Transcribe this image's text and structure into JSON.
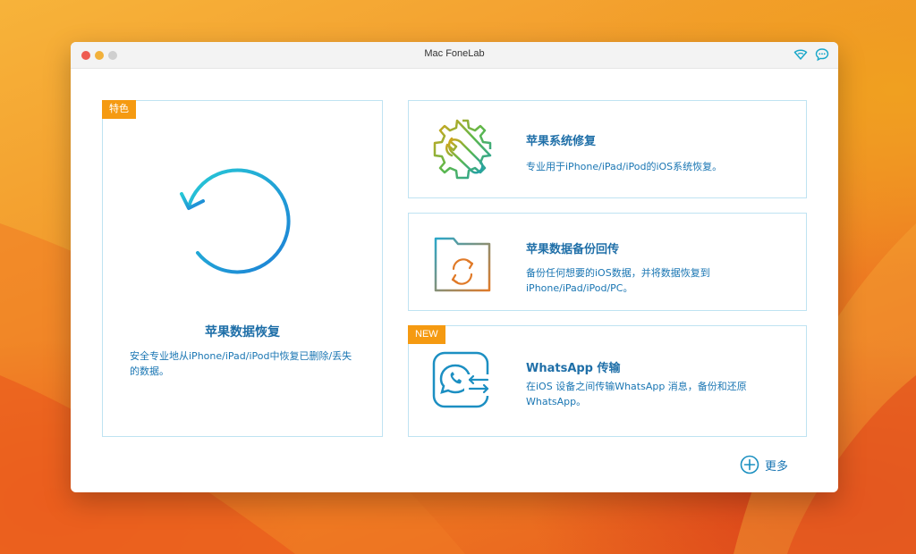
{
  "window": {
    "title": "Mac FoneLab"
  },
  "titlebar_icons": [
    "wifi-icon",
    "chat-icon"
  ],
  "main_card": {
    "badge": "特色",
    "title": "苹果数据恢复",
    "description": "安全专业地从iPhone/iPad/iPod中恢复已删除/丢失的数据。",
    "icon": "recover-plus-icon"
  },
  "features": [
    {
      "title": "苹果系统修复",
      "description": "专业用于iPhone/iPad/iPod的iOS系统恢复。",
      "icon": "gear-wrench-icon"
    },
    {
      "title": "苹果数据备份回传",
      "description": "备份任何想要的iOS数据，并将数据恢复到iPhone/iPad/iPod/PC。",
      "icon": "folder-sync-icon"
    },
    {
      "badge": "NEW",
      "title": "WhatsApp 传输",
      "description": "在iOS 设备之间传输WhatsApp 消息，备份和还原WhatsApp。",
      "icon": "whatsapp-transfer-icon"
    }
  ],
  "more": {
    "label": "更多",
    "icon": "plus-circle-icon"
  },
  "colors": {
    "accent": "#1a76b3",
    "badge": "#f59a11",
    "card_border": "#bfe3f2",
    "gradient_start": "#27c4d8",
    "gradient_end": "#1d7fd6"
  }
}
